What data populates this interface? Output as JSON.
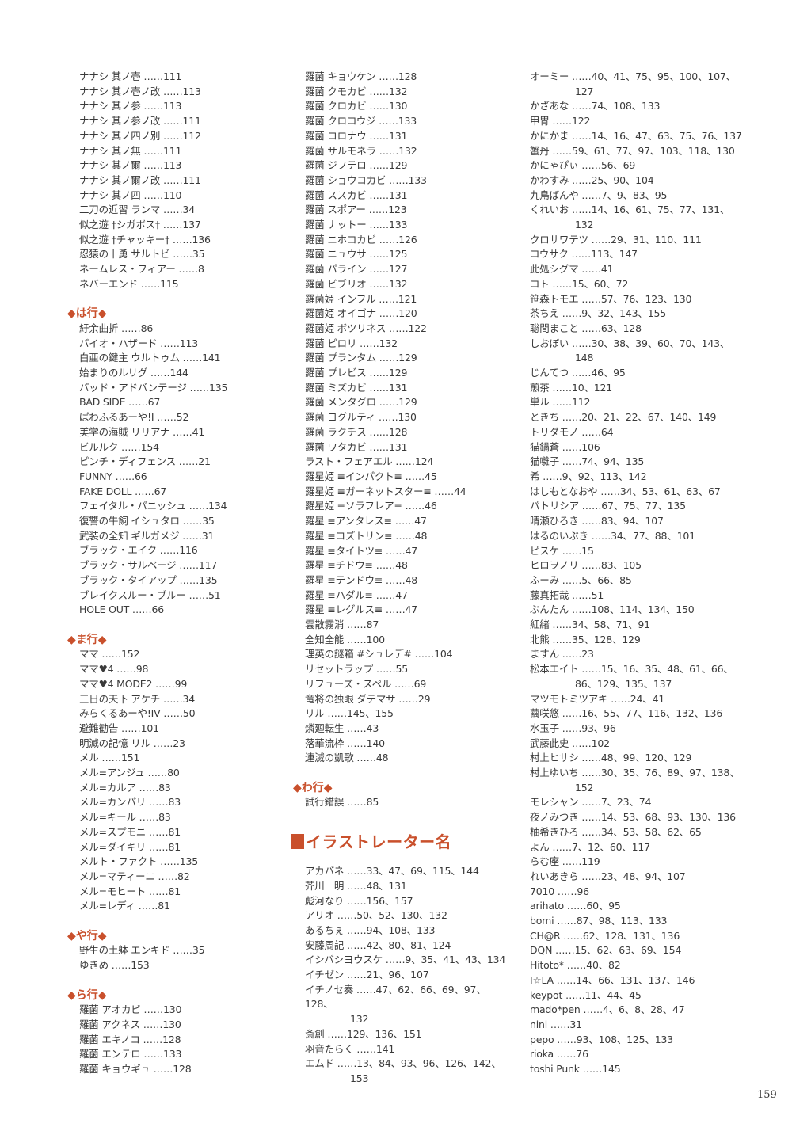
{
  "page_number": "159",
  "col1": {
    "entries_a": [
      "ナナシ 其ノ壱 ……111",
      "ナナシ 其ノ壱ノ改 ……113",
      "ナナシ 其ノ参 ……113",
      "ナナシ 其ノ参ノ改 ……111",
      "ナナシ 其ノ四ノ別 ……112",
      "ナナシ 其ノ無 ……111",
      "ナナシ 其ノ爾 ……113",
      "ナナシ 其ノ爾ノ改 ……111",
      "ナナシ 其ノ四 ……110",
      "二刀の近習 ランマ ……34",
      "似之遊 †シガボス† ……137",
      "似之遊 †チャッキー† ……136",
      "忍猿の十勇 サルトビ ……35",
      "ネームレス・フィアー ……8",
      "ネバーエンド ……115"
    ],
    "section_ha": "◆は行◆",
    "entries_ha": [
      "紆余曲折 ……86",
      "バイオ・ハザード ……113",
      "白亜の鍵主 ウルトゥム ……141",
      "始まりのルリグ ……144",
      "バッド・アドバンテージ ……135",
      "BAD SIDE ……67",
      "ぱわふるあーや!I ……52",
      "美学の海賊 リリアナ ……41",
      "ビルルク ……154",
      "ピンチ・ディフェンス ……21",
      "FUNNY ……66",
      "FAKE DOLL ……67",
      "フェイタル・パニッシュ ……134",
      "復讐の牛飼 イシュタロ ……35",
      "武装の全知 ギルガメジ ……31",
      "ブラック・エイク ……116",
      "ブラック・サルベージ ……117",
      "ブラック・タイアップ ……135",
      "ブレイクスルー・ブルー ……51",
      "HOLE OUT ……66"
    ],
    "section_ma": "◆ま行◆",
    "entries_ma": [
      "ママ ……152",
      "ママ♥4 ……98",
      "ママ♥4 MODE2 ……99",
      "三日の天下 アケチ ……34",
      "みらくるあーや!IV ……50",
      "避難勧告 ……101",
      "明滅の記憶 リル ……23",
      "メル ……151",
      "メル=アンジュ ……80",
      "メル=カルア ……83",
      "メル=カンパリ ……83",
      "メル=キール ……83",
      "メル=スプモニ ……81",
      "メル=ダイキリ ……81",
      "メルト・ファクト ……135",
      "メル=マティーニ ……82",
      "メル=モヒート ……81",
      "メル=レディ ……81"
    ],
    "section_ya": "◆や行◆",
    "entries_ya": [
      "野生の土躰 エンキド ……35",
      "ゆきめ ……153"
    ],
    "section_ra": "◆ら行◆",
    "entries_ra": [
      "羅菌 アオカビ ……130",
      "羅菌 アクネス ……130",
      "羅菌 エキノコ ……128",
      "羅菌 エンテロ ……133",
      "羅菌 キョウギュ ……128"
    ]
  },
  "col2": {
    "entries_a": [
      "羅菌 キョウケン ……128",
      "羅菌 クモカビ ……132",
      "羅菌 クロカビ ……130",
      "羅菌 クロコウジ ……133",
      "羅菌 コロナウ ……131",
      "羅菌 サルモネラ ……132",
      "羅菌 ジフテロ ……129",
      "羅菌 ショウコカビ ……133",
      "羅菌 ススカビ ……131",
      "羅菌 スポアー ……123",
      "羅菌 ナットー ……133",
      "羅菌 ニホコカビ ……126",
      "羅菌 ニュウサ ……125",
      "羅菌 パライン ……127",
      "羅菌 ビブリオ ……132",
      "羅菌姫 インフル ……121",
      "羅菌姫 オイゴナ ……120",
      "羅菌姫 ボツリネス ……122",
      "羅菌 ピロリ ……132",
      "羅菌 プランタム ……129",
      "羅菌 プレビス ……129",
      "羅菌 ミズカビ ……131",
      "羅菌 メンタグロ ……129",
      "羅菌 ヨグルティ ……130",
      "羅菌 ラクチス ……128",
      "羅菌 ワタカビ ……131",
      "ラスト・フェアエル ……124",
      "羅星姫 ≡インパクト≡ ……45",
      "羅星姫 ≡ガーネットスター≡ ……44",
      "羅星姫 ≡ソラフレア≡ ……46",
      "羅星 ≡アンタレス≡ ……47",
      "羅星 ≡コズトリン≡ ……48",
      "羅星 ≡タイトツ≡ ……47",
      "羅星 ≡チドウ≡ ……48",
      "羅星 ≡テンドウ≡ ……48",
      "羅星 ≡ハダル≡ ……47",
      "羅星 ≡レグルス≡ ……47",
      "雲散霧消 ……87",
      "全知全能 ……100",
      "理英の謎箱 #シュレデ# ……104",
      "リセットラップ ……55",
      "リフューズ・スペル ……69",
      "竜将の独眼 ダテマサ ……29",
      "リル ……145、155",
      "燐廻転生 ……43",
      "落華流枠 ……140",
      "連滅の凱歌 ……48"
    ],
    "section_wa": "◆わ行◆",
    "entries_wa": [
      "試行錯誤 ……85"
    ],
    "illustrator_heading": "イラストレーター名",
    "illustrators": [
      {
        "text": "アカバネ ……33、47、69、115、144"
      },
      {
        "text": "芥川　明 ……48、131"
      },
      {
        "text": "彪河なり ……156、157"
      },
      {
        "text": "アリオ ……50、52、130、132"
      },
      {
        "text": "あるちぇ ……94、108、133"
      },
      {
        "text": "安藤周記 ……42、80、81、124"
      },
      {
        "text": "イシバシヨウスケ ……9、35、41、43、134"
      },
      {
        "text": "イチゼン ……21、96、107"
      },
      {
        "text": "イチノセ奏 ……47、62、66、69、97、128、",
        "cont": "132"
      },
      {
        "text": "斎創 ……129、136、151"
      },
      {
        "text": "羽音たらく ……141"
      },
      {
        "text": "エムド ……13、84、93、96、126、142、",
        "cont": "153"
      }
    ]
  },
  "col3": {
    "illustrators": [
      {
        "text": "オーミー ……40、41、75、95、100、107、",
        "cont": "127"
      },
      {
        "text": "かざあな ……74、108、133"
      },
      {
        "text": "甲冑 ……122"
      },
      {
        "text": "かにかま ……14、16、47、63、75、76、137"
      },
      {
        "text": "蟹丹 ……59、61、77、97、103、118、130"
      },
      {
        "text": "かにゃぴぃ ……56、69"
      },
      {
        "text": "かわすみ ……25、90、104"
      },
      {
        "text": "九鳥ばんや ……7、9、83、95"
      },
      {
        "text": "くれいお ……14、16、61、75、77、131、",
        "cont": "132"
      },
      {
        "text": "クロサワテツ ……29、31、110、111"
      },
      {
        "text": "コウサク ……113、147"
      },
      {
        "text": "此処シグマ ……41"
      },
      {
        "text": "コト ……15、60、72"
      },
      {
        "text": "笹森トモエ ……57、76、123、130"
      },
      {
        "text": "茶ちえ ……9、32、143、155"
      },
      {
        "text": "聡間まこと ……63、128"
      },
      {
        "text": "しおぼい ……30、38、39、60、70、143、",
        "cont": "148"
      },
      {
        "text": "じんてつ ……46、95"
      },
      {
        "text": "煎茶 ……10、121"
      },
      {
        "text": "単ル ……112"
      },
      {
        "text": "ときち ……20、21、22、67、140、149"
      },
      {
        "text": "トリダモノ ……64"
      },
      {
        "text": "猫鍋蒼 ……106"
      },
      {
        "text": "猫囃子 ……74、94、135"
      },
      {
        "text": "希 ……9、92、113、142"
      },
      {
        "text": "はしもとなおや ……34、53、61、63、67"
      },
      {
        "text": "パトリシア ……67、75、77、135"
      },
      {
        "text": "晴瀬ひろき ……83、94、107"
      },
      {
        "text": "はるのいぶき ……34、77、88、101"
      },
      {
        "text": "ピスケ ……15"
      },
      {
        "text": "ヒロヲノリ ……83、105"
      },
      {
        "text": "ふーみ ……5、66、85"
      },
      {
        "text": "藤真拓哉 ……51"
      },
      {
        "text": "ぶんたん ……108、114、134、150"
      },
      {
        "text": "紅緒 ……34、58、71、91"
      },
      {
        "text": "北熊 ……35、128、129"
      },
      {
        "text": "ますん ……23"
      },
      {
        "text": "松本エイト ……15、16、35、48、61、66、",
        "cont": "86、129、135、137"
      },
      {
        "text": "マツモトミツアキ ……24、41"
      },
      {
        "text": "繭咲悠 ……16、55、77、116、132、136"
      },
      {
        "text": "水玉子 ……93、96"
      },
      {
        "text": "武藤此史 ……102"
      },
      {
        "text": "村上ヒサシ ……48、99、120、129"
      },
      {
        "text": "村上ゆいち ……30、35、76、89、97、138、",
        "cont": "152"
      },
      {
        "text": "モレシャン ……7、23、74"
      },
      {
        "text": "夜ノみつき ……14、53、68、93、130、136"
      },
      {
        "text": "柚希きひろ ……34、53、58、62、65"
      },
      {
        "text": "よん ……7、12、60、117"
      },
      {
        "text": "らむ座 ……119"
      },
      {
        "text": "れいあきら ……23、48、94、107"
      },
      {
        "text": "7010 ……96"
      },
      {
        "text": "arihato ……60、95"
      },
      {
        "text": "bomi ……87、98、113、133"
      },
      {
        "text": "CH@R ……62、128、131、136"
      },
      {
        "text": "DQN ……15、62、63、69、154"
      },
      {
        "text": "Hitoto* ……40、82"
      },
      {
        "text": "I☆LA ……14、66、131、137、146"
      },
      {
        "text": "keypot ……11、44、45"
      },
      {
        "text": "mado*pen ……4、6、8、28、47"
      },
      {
        "text": "nini ……31"
      },
      {
        "text": "pepo ……93、108、125、133"
      },
      {
        "text": "rioka ……76"
      },
      {
        "text": "toshi Punk ……145"
      }
    ]
  },
  "colors": {
    "heading": "#c9502c",
    "text": "#3a3a3a"
  }
}
